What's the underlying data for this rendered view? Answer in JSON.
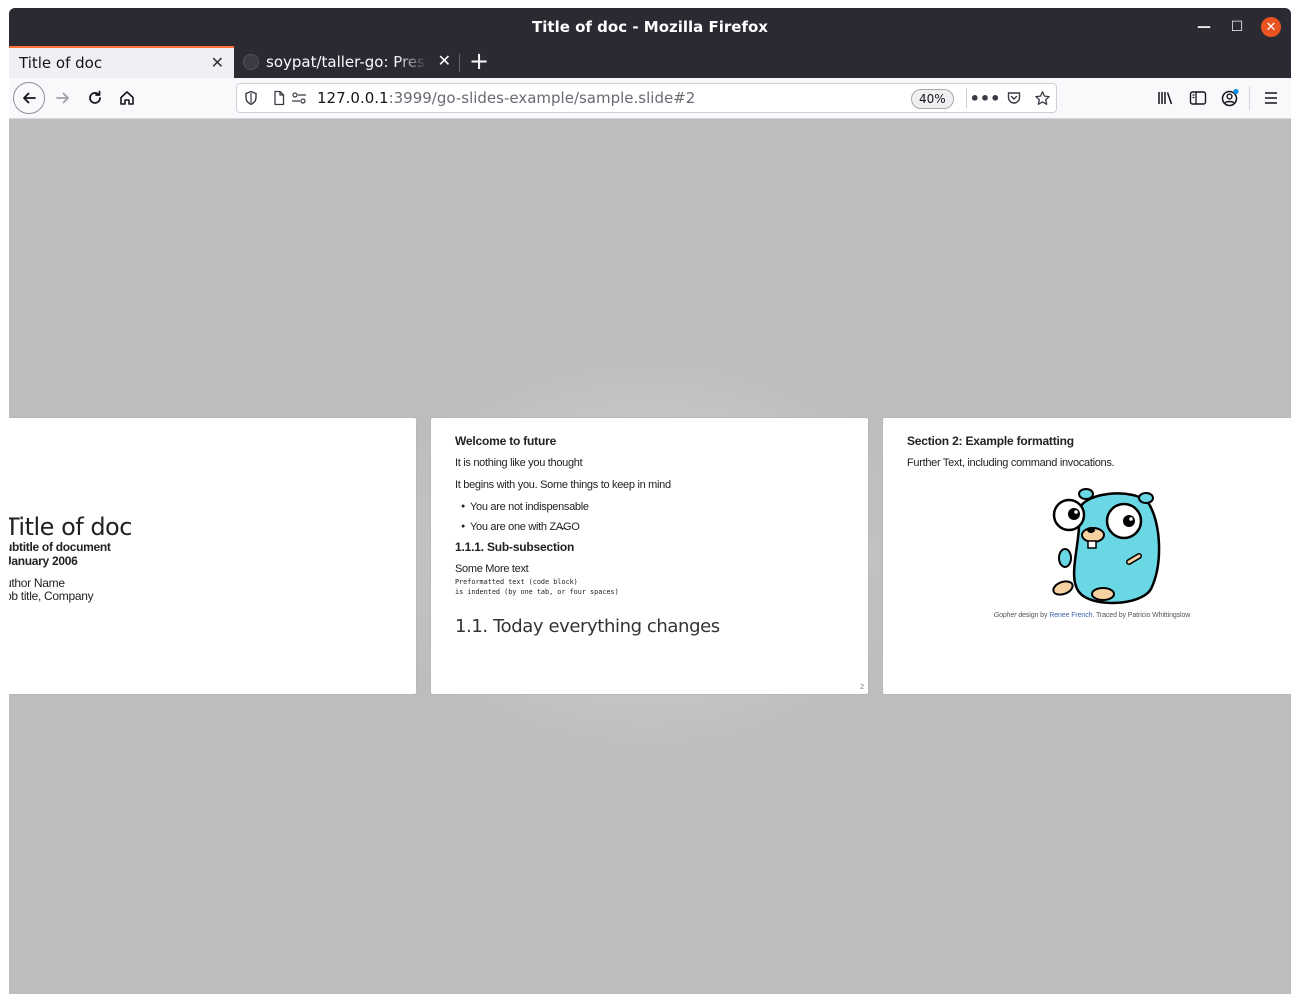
{
  "window": {
    "title": "Title of doc - Mozilla Firefox"
  },
  "tabs": [
    {
      "label": "Title of doc",
      "active": true
    },
    {
      "label": "soypat/taller-go: Presentations",
      "active": false
    }
  ],
  "urlbar": {
    "host": "127.0.0.1",
    "rest": ":3999/go-slides-example/sample.slide#2",
    "zoom": "40%"
  },
  "icons": [
    "back-icon",
    "forward-icon",
    "reload-icon",
    "home-icon",
    "shield-icon",
    "page-icon",
    "permissions-icon",
    "more-icon",
    "pocket-icon",
    "star-icon",
    "library-icon",
    "sidebar-icon",
    "account-icon",
    "menu-icon"
  ],
  "slides": {
    "title_slide": {
      "title": "Title of doc",
      "subtitle": "ubtitle of document",
      "date": "January 2006",
      "author": "uthor Name",
      "job": "ob title, Company"
    },
    "current_slide": {
      "heading": "Welcome to future",
      "p1": "It is nothing like you thought",
      "p2": "It begins with you. Some things to keep in mind",
      "bullets": [
        "You are not indispensable",
        "You are one with ZA̶GO"
      ],
      "subsection": "1.1.1. Sub-subsection",
      "more": "Some More text",
      "pre1": "Preformatted text (code block)",
      "pre2": "is indented (by one tab, or four spaces)",
      "big": "1.1. Today everything changes",
      "page": "2"
    },
    "next_slide": {
      "heading": "Section 2: Example formatting",
      "p1": "Further Text, including command invocations.",
      "caption_em": "Gopher",
      "caption_mid": " design by ",
      "caption_link": "Renee French",
      "caption_end": ". Traced by Patricio Whittingslow"
    }
  },
  "colors": {
    "accent": "#ff7139",
    "close": "#e95420",
    "background": "#bdbdbd",
    "gopher": "#6ad7e5"
  }
}
